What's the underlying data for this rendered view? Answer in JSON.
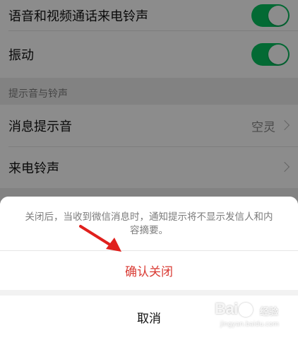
{
  "settings": {
    "items": [
      {
        "label": "语音和视频通话来电铃声",
        "toggle_on": true
      },
      {
        "label": "振动",
        "toggle_on": true
      }
    ],
    "section_header": "提示音与铃声",
    "sound_items": [
      {
        "label": "消息提示音",
        "value": "空灵"
      },
      {
        "label": "来电铃声",
        "value": ""
      }
    ]
  },
  "action_sheet": {
    "message": "关闭后，当收到微信消息时，通知提示将不显示发信人和内容摘要。",
    "confirm_label": "确认关闭",
    "cancel_label": "取消"
  },
  "watermark": {
    "brand": "Bai",
    "brand_suffix": "经验",
    "url": "jingyan.baidu.com"
  },
  "colors": {
    "toggle_on": "#07c160",
    "destructive": "#d93a33",
    "annotation_arrow": "#e0201d"
  }
}
